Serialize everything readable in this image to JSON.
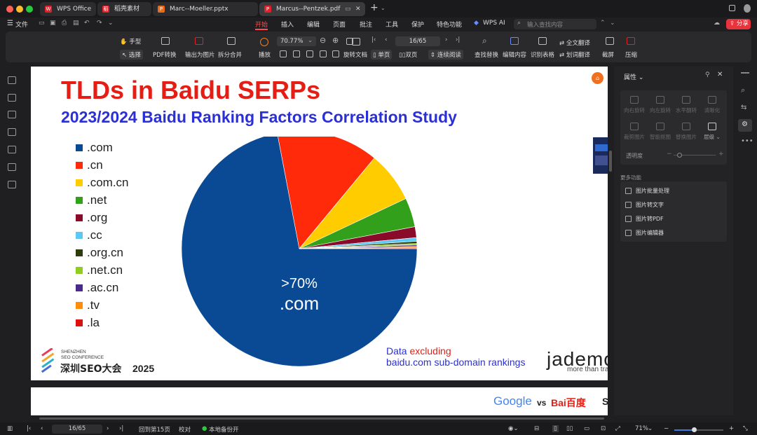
{
  "tabs": [
    {
      "label": "WPS Office"
    },
    {
      "label": "稻壳素材"
    },
    {
      "label": "Marc--Moeller.pptx"
    },
    {
      "label": "Marcus--Pentzek.pdf"
    }
  ],
  "menu": {
    "file": "文件",
    "items": [
      "开始",
      "插入",
      "编辑",
      "页面",
      "批注",
      "工具",
      "保护",
      "特色功能"
    ],
    "ai": "WPS AI",
    "search_placeholder": "输入查找内容",
    "share": "分享"
  },
  "ribbon": {
    "hand": "手型",
    "select": "选择",
    "pdf_convert": "PDF转换",
    "export_image": "输出为图片",
    "split_merge": "拆分合并",
    "play": "播放",
    "zoom": "70.77%",
    "page": "16/65",
    "rotate": "旋转文档",
    "single": "单页",
    "double": "双页",
    "continuous": "连续阅读",
    "find_replace": "查找替换",
    "edit_content": "编辑内容",
    "recognize_table": "识别表格",
    "full_translate": "全文翻译",
    "word_translate": "划词翻译",
    "screenshot": "截屏",
    "compress": "压缩"
  },
  "slide": {
    "title": "TLDs in Baidu SERPs",
    "subtitle": "2023/2024 Baidu Ranking Factors Correlation Study",
    "pie_label_1": ">70%",
    "pie_label_2": ".com",
    "note_1a": "Data ",
    "note_1b": "excluding",
    "note_2": "baidu.com sub-domain rankings",
    "conf_1": "SHENZHEN",
    "conf_2": "SEO CONFERENCE",
    "conf_cn": "深圳SEO大会",
    "conf_year": "2025",
    "brand": "jademon",
    "brand_tag": "more than tra"
  },
  "chart_data": {
    "type": "pie",
    "categories": [
      ".com",
      ".cn",
      ".com.cn",
      ".net",
      ".org",
      ".cc",
      ".org.cn",
      ".net.cn",
      ".ac.cn",
      ".tv",
      ".la"
    ],
    "values": [
      72,
      14,
      7,
      4,
      1.5,
      0.5,
      0.3,
      0.2,
      0.2,
      0.2,
      0.1
    ],
    "colors": [
      "#0a4a94",
      "#ff2a0a",
      "#ffcc00",
      "#33a01c",
      "#8a0a2a",
      "#5bc8f5",
      "#2d3d0a",
      "#8fce1e",
      "#4a2a8a",
      "#ff8c0a",
      "#dd1010"
    ],
    "annotation": ">70% .com",
    "legend_position": "left"
  },
  "slide2": {
    "google": "Google",
    "vs": "vs",
    "baidu": "Bai百度",
    "s": "S"
  },
  "panel": {
    "title": "属性",
    "tools": [
      "向右旋转",
      "向左旋转",
      "水平翻转",
      "清晰化",
      "裁剪图片",
      "智能抠图",
      "替换图片",
      "层级"
    ],
    "opacity": "透明度",
    "more_title": "更多功能",
    "more": [
      "图片批量处理",
      "图片转文字",
      "图片转PDF",
      "图片编辑器"
    ]
  },
  "status": {
    "page": "16/65",
    "back": "回到第15页",
    "proof": "校对",
    "backup": "本地备份开",
    "zoom": "71%"
  }
}
